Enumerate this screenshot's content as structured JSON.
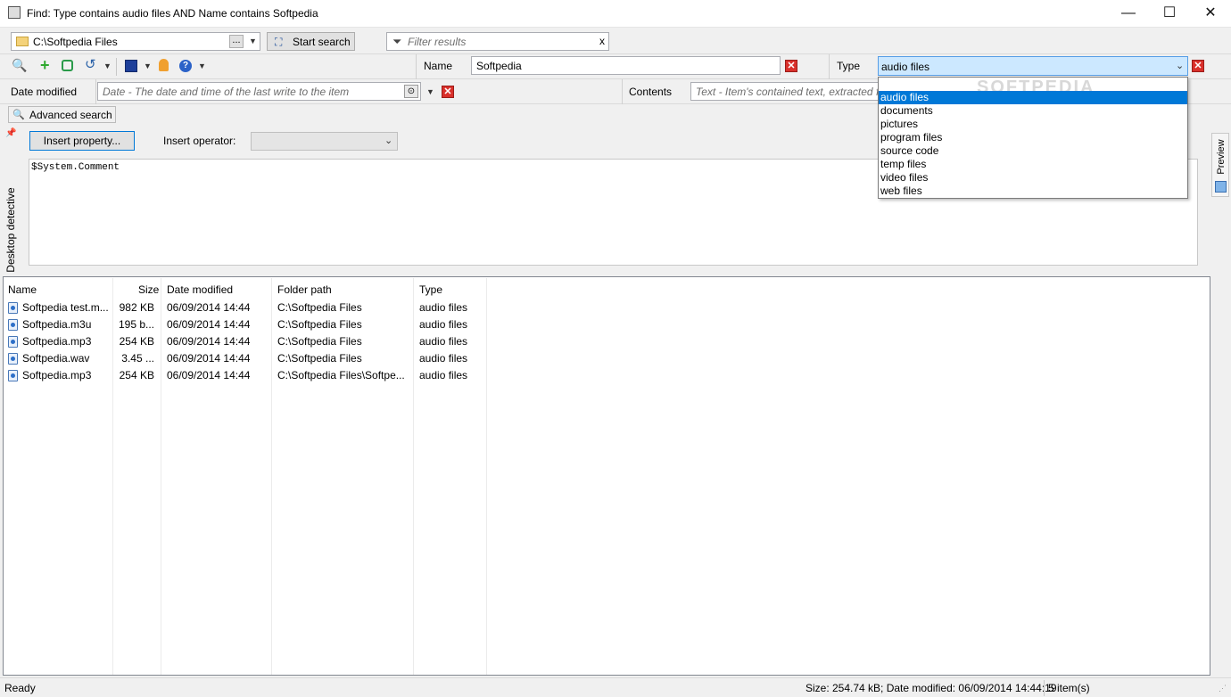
{
  "window": {
    "title": "Find: Type contains audio files AND Name contains Softpedia",
    "minimize": "—",
    "maximize": "☐",
    "close": "✕"
  },
  "toolbar1": {
    "location": "C:\\Softpedia Files",
    "browse_label": "...",
    "start_search_label": "Start search",
    "filter_placeholder": "Filter results",
    "filter_clear": "x"
  },
  "criteria": {
    "name_label": "Name",
    "name_value": "Softpedia",
    "type_label": "Type",
    "type_value": "audio files",
    "date_label": "Date modified",
    "date_placeholder": "Date - The date and time of the last write to the item",
    "contents_label": "Contents",
    "contents_placeholder": "Text - Item's contained text, extracted fr"
  },
  "type_dropdown": {
    "options": [
      "audio files",
      "documents",
      "pictures",
      "program files",
      "source code",
      "temp files",
      "video files",
      "web files"
    ],
    "selected_index": 0
  },
  "advanced": {
    "toggle_label": "Advanced search",
    "insert_property_label": "Insert property...",
    "insert_operator_label": "Insert operator:",
    "query_text": "$System.Comment"
  },
  "side_panels": {
    "left_label": "Desktop detective",
    "right_label": "Preview"
  },
  "results": {
    "columns": [
      "Name",
      "Size",
      "Date modified",
      "Folder path",
      "Type"
    ],
    "rows": [
      {
        "name": "Softpedia test.m...",
        "size": "982 KB",
        "date": "06/09/2014 14:44",
        "folder": "C:\\Softpedia Files",
        "type": "audio files"
      },
      {
        "name": "Softpedia.m3u",
        "size": "195 b...",
        "date": "06/09/2014 14:44",
        "folder": "C:\\Softpedia Files",
        "type": "audio files"
      },
      {
        "name": "Softpedia.mp3",
        "size": "254 KB",
        "date": "06/09/2014 14:44",
        "folder": "C:\\Softpedia Files",
        "type": "audio files"
      },
      {
        "name": "Softpedia.wav",
        "size": "3.45 ...",
        "date": "06/09/2014 14:44",
        "folder": "C:\\Softpedia Files",
        "type": "audio files"
      },
      {
        "name": "Softpedia.mp3",
        "size": "254 KB",
        "date": "06/09/2014 14:44",
        "folder": "C:\\Softpedia Files\\Softpe...",
        "type": "audio files"
      }
    ]
  },
  "status": {
    "left": "Ready",
    "summary": "Size: 254.74 kB; Date modified: 06/09/2014 14:44:19",
    "count": "5 item(s)"
  },
  "watermark": "SOFTPEDIA",
  "colors": {
    "selection": "#cce8ff",
    "dropdown_highlight": "#0078d7",
    "clear_button": "#d9302b",
    "add_icon": "#2ea82e",
    "save_icon": "#1e3f9a"
  }
}
